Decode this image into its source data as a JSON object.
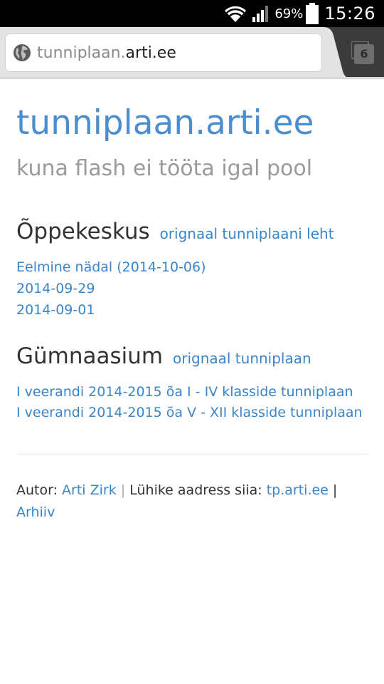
{
  "status_bar": {
    "battery_percent": "69%",
    "time": "15:26"
  },
  "browser": {
    "url_prefix": "tunniplaan.",
    "url_host": "arti.ee",
    "tab_count": "6"
  },
  "page": {
    "title": "tunniplaan.arti.ee",
    "tagline": "kuna flash ei tööta igal pool",
    "sections": [
      {
        "heading": "Õppekeskus",
        "heading_link": "orignaal tunniplaani leht",
        "links": [
          "Eelmine nädal (2014-10-06)",
          "2014-09-29",
          "2014-09-01"
        ]
      },
      {
        "heading": "Gümnaasium",
        "heading_link": "orignaal tunniplaan",
        "links": [
          "I veerandi 2014-2015 õa I - IV klasside tunniplaan",
          "I veerandi 2014-2015 õa V - XII klasside tunniplaan"
        ]
      }
    ],
    "footer": {
      "author_label": "Autor:",
      "author_name": "Arti Zirk",
      "separator1": "|",
      "short_address_label": "Lühike aadress siia:",
      "short_address": "tp.arti.ee",
      "separator2": "|",
      "archive": "Arhiiv"
    }
  },
  "colors": {
    "link": "#3a85c8",
    "title": "#4a8ed0",
    "tagline": "#9a9a9a",
    "chrome": "#e3e3e3"
  },
  "icons": {
    "globe": "globe-icon",
    "wifi": "wifi-icon",
    "signal": "signal-icon",
    "battery": "battery-icon",
    "tabs": "tab-switcher-icon"
  }
}
